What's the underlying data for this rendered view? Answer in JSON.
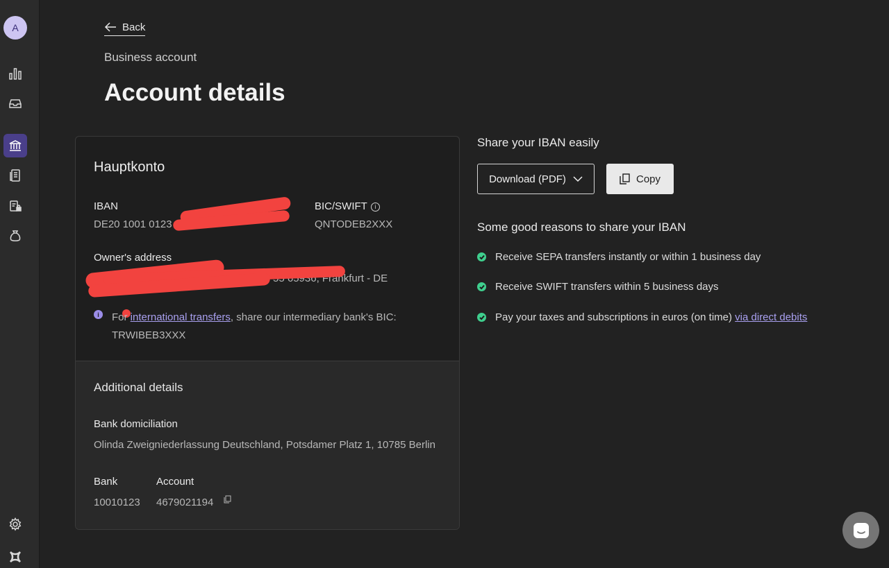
{
  "sidebar": {
    "avatar_initial": "A",
    "items": [
      {
        "icon": "bar-chart-icon"
      },
      {
        "icon": "inbox-icon"
      },
      {
        "icon": "bank-icon",
        "active": true
      },
      {
        "icon": "invoice-icon"
      },
      {
        "icon": "locked-document-icon"
      },
      {
        "icon": "money-bag-icon"
      },
      {
        "icon": "settings-icon"
      },
      {
        "icon": "logo-icon"
      }
    ],
    "accent_color": "#4a3f8a"
  },
  "header": {
    "back_label": "Back",
    "subtitle": "Business account",
    "title": "Account details"
  },
  "account_card": {
    "name": "Hauptkonto",
    "iban_label": "IBAN",
    "iban_value": "DE20 1001 0123 46",
    "bic_label": "BIC/SWIFT",
    "bic_value": "QNTODEB2XXX",
    "owner_address_label": "Owner's address",
    "owner_address_value": "55 65936, Frankfurt - DE",
    "intl_note_prefix": "For ",
    "intl_note_link": "international transfers",
    "intl_note_suffix": ", share our intermediary bank's BIC:",
    "intl_bic": "TRWIBEB3XXX"
  },
  "additional_details": {
    "title": "Additional details",
    "domiciliation_label": "Bank domiciliation",
    "domiciliation_value": "Olinda Zweigniederlassung Deutschland, Potsdamer Platz 1, 10785 Berlin",
    "bank_label": "Bank",
    "bank_value": "10010123",
    "account_label": "Account",
    "account_value": "4679021194"
  },
  "share": {
    "heading": "Share your IBAN easily",
    "download_label": "Download (PDF)",
    "copy_label": "Copy"
  },
  "reasons": {
    "heading": "Some good reasons to share your IBAN",
    "items": [
      {
        "text": "Receive SEPA transfers instantly or within 1 business day"
      },
      {
        "text": "Receive SWIFT transfers within 5 business days"
      },
      {
        "text": "Pay your taxes and subscriptions in euros (on time) ",
        "link": "via direct debits"
      }
    ],
    "check_color": "#3fcf8e"
  },
  "colors": {
    "background": "#222222",
    "card": "#1e1e1e",
    "link": "#a9a0f0",
    "redaction": "#f2433f"
  }
}
